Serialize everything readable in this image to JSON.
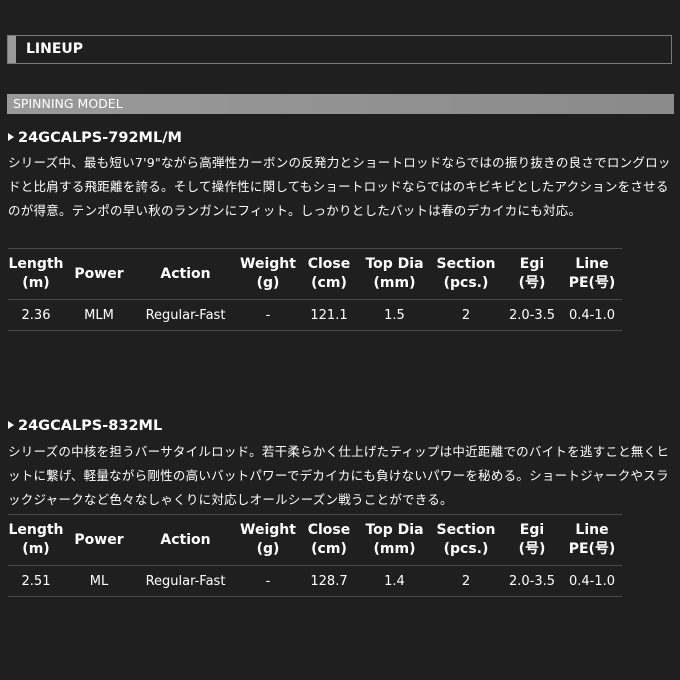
{
  "lineup": {
    "title": "LINEUP"
  },
  "model": {
    "title": "SPINNING MODEL"
  },
  "columns": [
    [
      "Length",
      "(m)"
    ],
    [
      "Power",
      ""
    ],
    [
      "Action",
      ""
    ],
    [
      "Weight",
      "(g)"
    ],
    [
      "Close",
      "(cm)"
    ],
    [
      "Top Dia",
      "(mm)"
    ],
    [
      "Section",
      "(pcs.)"
    ],
    [
      "Egi",
      "(号)"
    ],
    [
      "Line",
      "PE(号)"
    ]
  ],
  "rods": [
    {
      "name": "24GCALPS-792ML/M",
      "description": "シリーズ中、最も短い7'9\"ながら高弾性カーボンの反発力とショートロッドならではの振り抜きの良さでロングロッドと比肩する飛距離を誇る。そして操作性に関してもショートロッドならではのキビキビとしたアクションをさせるのが得意。テンポの早い秋のランガンにフィット。しっかりとしたバットは春のデカイカにも対応。",
      "specs": [
        "2.36",
        "MLM",
        "Regular-Fast",
        "-",
        "121.1",
        "1.5",
        "2",
        "2.0-3.5",
        "0.4-1.0"
      ]
    },
    {
      "name": "24GCALPS-832ML",
      "description": "シリーズの中核を担うバーサタイルロッド。若干柔らかく仕上げたティップは中近距離でのバイトを逃すこと無くヒットに繋げ、軽量ながら剛性の高いバットパワーでデカイカにも負けないパワーを秘める。ショートジャークやスラックジャークなど色々なしゃくりに対応しオールシーズン戦うことができる。",
      "specs": [
        "2.51",
        "ML",
        "Regular-Fast",
        "-",
        "128.7",
        "1.4",
        "2",
        "2.0-3.5",
        "0.4-1.0"
      ]
    }
  ]
}
